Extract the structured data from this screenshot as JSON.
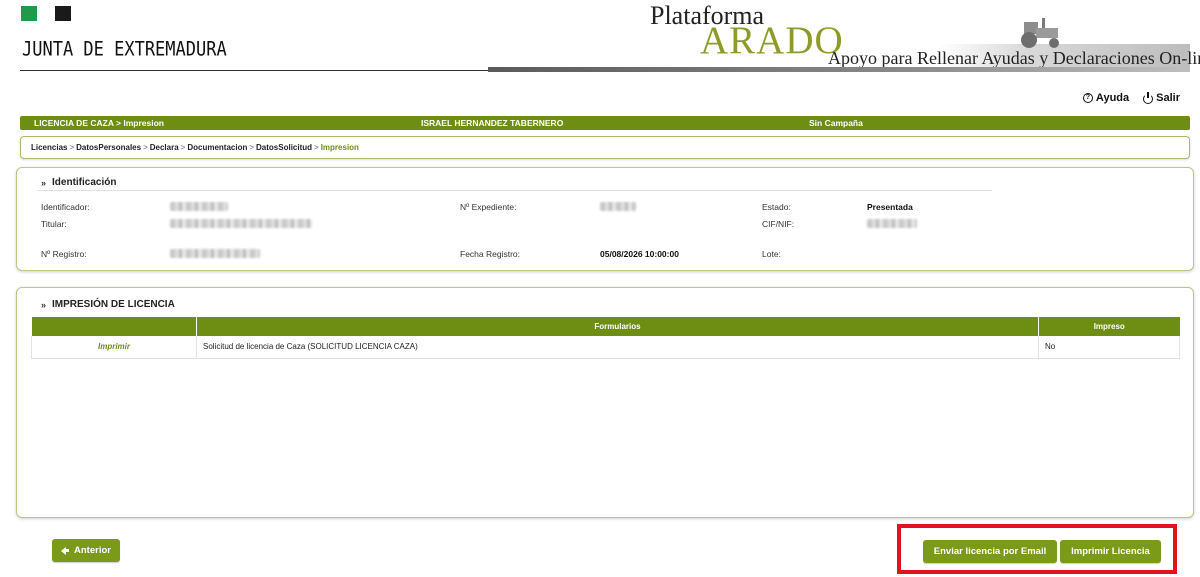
{
  "header": {
    "gov_name": "JUNTA DE EXTREMADURA",
    "platform_label": "Plataforma",
    "platform_name": "ARADO",
    "tagline": "Apoyo para Rellenar Ayudas y Declaraciones On-line",
    "colors": {
      "flag_green": "#1f9a4a",
      "flag_black": "#1a1a1a",
      "arado_green": "#8e9a2a"
    }
  },
  "top_links": {
    "help": "Ayuda",
    "exit": "Salir",
    "help_icon": "question-circle-icon",
    "exit_icon": "power-icon"
  },
  "status_bar": {
    "left": "LICENCIA DE CAZA > Impresion",
    "center": "ISRAEL HERNANDEZ TABERNERO",
    "right": "Sin Campaña",
    "color": "#6d8e12"
  },
  "breadcrumb": [
    "Licencias",
    "DatosPersonales",
    "Declara",
    "Documentacion",
    "DatosSolicitud",
    "Impresion"
  ],
  "identificacion": {
    "title": "Identificación",
    "identificador_label": "Identificador:",
    "titular_label": "Titular:",
    "registro_label": "Nº Registro:",
    "expediente_label": "Nº Expediente:",
    "fecha_label": "Fecha Registro:",
    "fecha_value": "05/08/2026 10:00:00",
    "estado_label": "Estado:",
    "estado_value": "Presentada",
    "cif_label": "CIF/NIF:",
    "lote_label": "Lote:"
  },
  "impresion": {
    "title": "IMPRESIÓN DE LICENCIA",
    "columns": [
      "",
      "Formularios",
      "Impreso"
    ],
    "rows": [
      {
        "action": "Imprimir",
        "form": "Solicitud de licencia de Caza (SOLICITUD LICENCIA CAZA)",
        "printed": "No"
      }
    ]
  },
  "buttons": {
    "anterior": "Anterior",
    "email": "Enviar licencia por Email",
    "print": "Imprimir Licencia",
    "highlight_color": "#e0141e"
  }
}
